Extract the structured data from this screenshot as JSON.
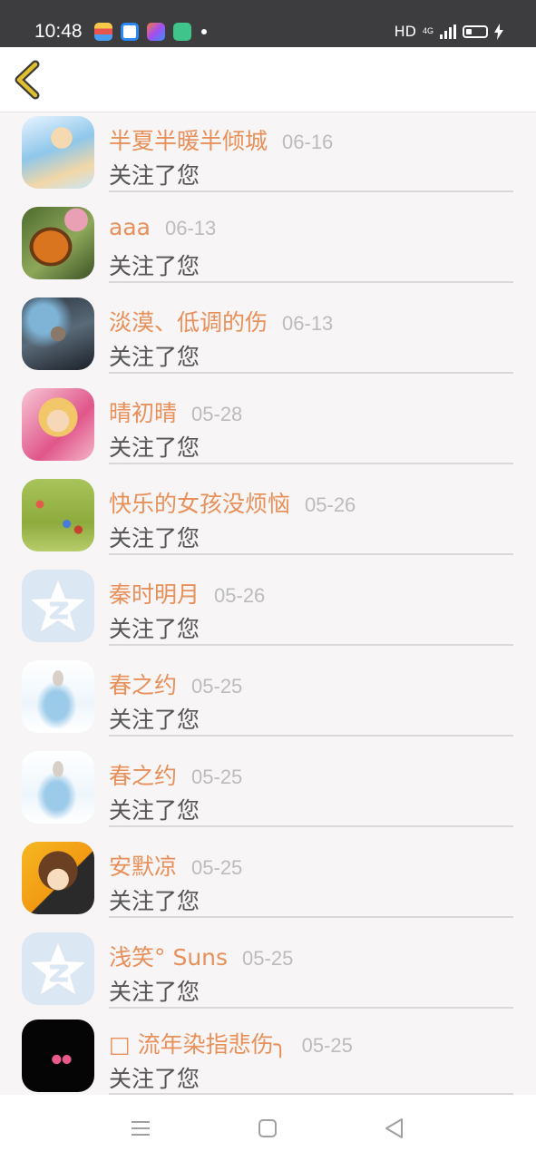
{
  "status_bar": {
    "time": "10:48",
    "hd": "HD",
    "network": "4G",
    "apps": [
      "app-icon-1",
      "app-icon-2",
      "app-icon-3",
      "app-icon-4"
    ]
  },
  "header": {
    "back_icon": "chevron-left-icon",
    "accent_color": "#e0c030"
  },
  "notifications": [
    {
      "name": "半夏半暖半倾城",
      "date": "06-16",
      "message": "关注了您",
      "avatar": "anime-girl-avatar"
    },
    {
      "name": "aaa",
      "date": "06-13",
      "message": "关注了您",
      "avatar": "butterfly-avatar"
    },
    {
      "name": "淡漠、低调的伤",
      "date": "06-13",
      "message": "关注了您",
      "avatar": "dark-warrior-avatar"
    },
    {
      "name": "晴初晴",
      "date": "05-28",
      "message": "关注了您",
      "avatar": "pink-girl-avatar"
    },
    {
      "name": "快乐的女孩没烦恼",
      "date": "05-26",
      "message": "关注了您",
      "avatar": "grass-field-avatar"
    },
    {
      "name": "秦时明月",
      "date": "05-26",
      "message": "关注了您",
      "avatar": "default-star-avatar"
    },
    {
      "name": "春之约",
      "date": "05-25",
      "message": "关注了您",
      "avatar": "mermaid-avatar"
    },
    {
      "name": "春之约",
      "date": "05-25",
      "message": "关注了您",
      "avatar": "mermaid-avatar"
    },
    {
      "name": "安默凉",
      "date": "05-25",
      "message": "关注了您",
      "avatar": "anime-boy-avatar"
    },
    {
      "name": "浅笑° Suns",
      "date": "05-25",
      "message": "关注了您",
      "avatar": "default-star-avatar"
    },
    {
      "name": "□ 流年染指悲伤╮",
      "date": "05-25",
      "message": "关注了您",
      "avatar": "black-text-avatar"
    }
  ],
  "colors": {
    "name": "#e8905a",
    "date": "#bcbcbc",
    "message": "#555555",
    "background": "#f7f5f6"
  },
  "bottom_nav": [
    "menu-icon",
    "home-square-icon",
    "back-triangle-icon"
  ]
}
